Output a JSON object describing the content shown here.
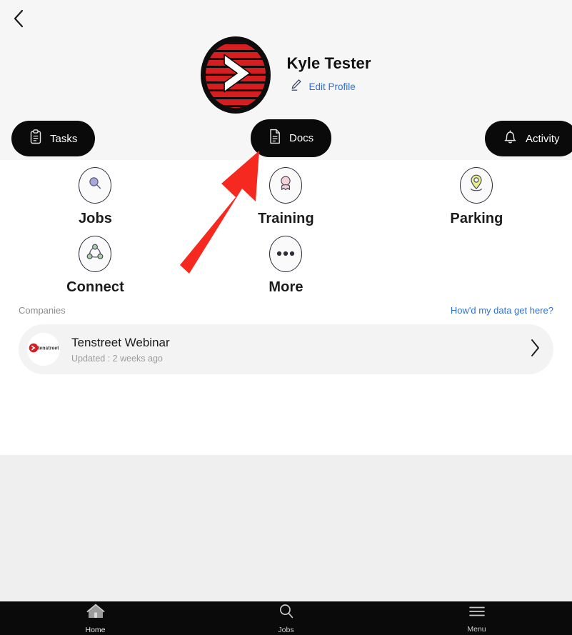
{
  "header": {
    "back_icon": "chevron-left-icon",
    "profile": {
      "name": "Kyle Tester",
      "avatar_icon": "company-chevron-logo",
      "edit_label": "Edit Profile",
      "edit_icon": "pencil-icon",
      "edit_color": "#2e6fd6"
    },
    "pills": [
      {
        "id": "tasks",
        "label": "Tasks",
        "icon": "clipboard-icon"
      },
      {
        "id": "docs",
        "label": "Docs",
        "icon": "document-icon"
      },
      {
        "id": "activity",
        "label": "Activity",
        "icon": "bell-icon"
      }
    ]
  },
  "main": {
    "tiles": [
      {
        "label": "Jobs",
        "icon": "magnifier-icon",
        "color": "#a9a8dd"
      },
      {
        "label": "Training",
        "icon": "person-icon",
        "color": "#f5d2d6"
      },
      {
        "label": "Parking",
        "icon": "map-pin-icon",
        "color": "#eaef86"
      },
      {
        "label": "Connect",
        "icon": "network-icon",
        "color": "#a9cfa2"
      },
      {
        "label": "More",
        "icon": "ellipsis-icon",
        "color": "#2c2c3a"
      }
    ],
    "companies": {
      "section_title": "Companies",
      "help_link": "How'd my data get here?",
      "items": [
        {
          "name": "Tenstreet Webinar",
          "subtitle": "Updated : 2 weeks ago",
          "logo_icon": "tenstreet-logo",
          "chevron_icon": "chevron-right-icon"
        }
      ]
    }
  },
  "bottom_nav": {
    "items": [
      {
        "label": "Home",
        "icon": "home-icon",
        "active": true
      },
      {
        "label": "Jobs",
        "icon": "magnifier-icon",
        "active": false
      },
      {
        "label": "Menu",
        "icon": "hamburger-icon",
        "active": false
      }
    ]
  },
  "annotation": {
    "type": "arrow",
    "color": "#f5291f",
    "points_to": "docs-pill"
  },
  "colors": {
    "header_bg": "#f6f6f6",
    "content_bg": "#ffffff",
    "page_bg": "#efefef",
    "pill_bg": "#0a0a0a",
    "nav_bg": "#0a0a0a",
    "link": "#2e6fd6",
    "brand_red": "#d61d20"
  }
}
